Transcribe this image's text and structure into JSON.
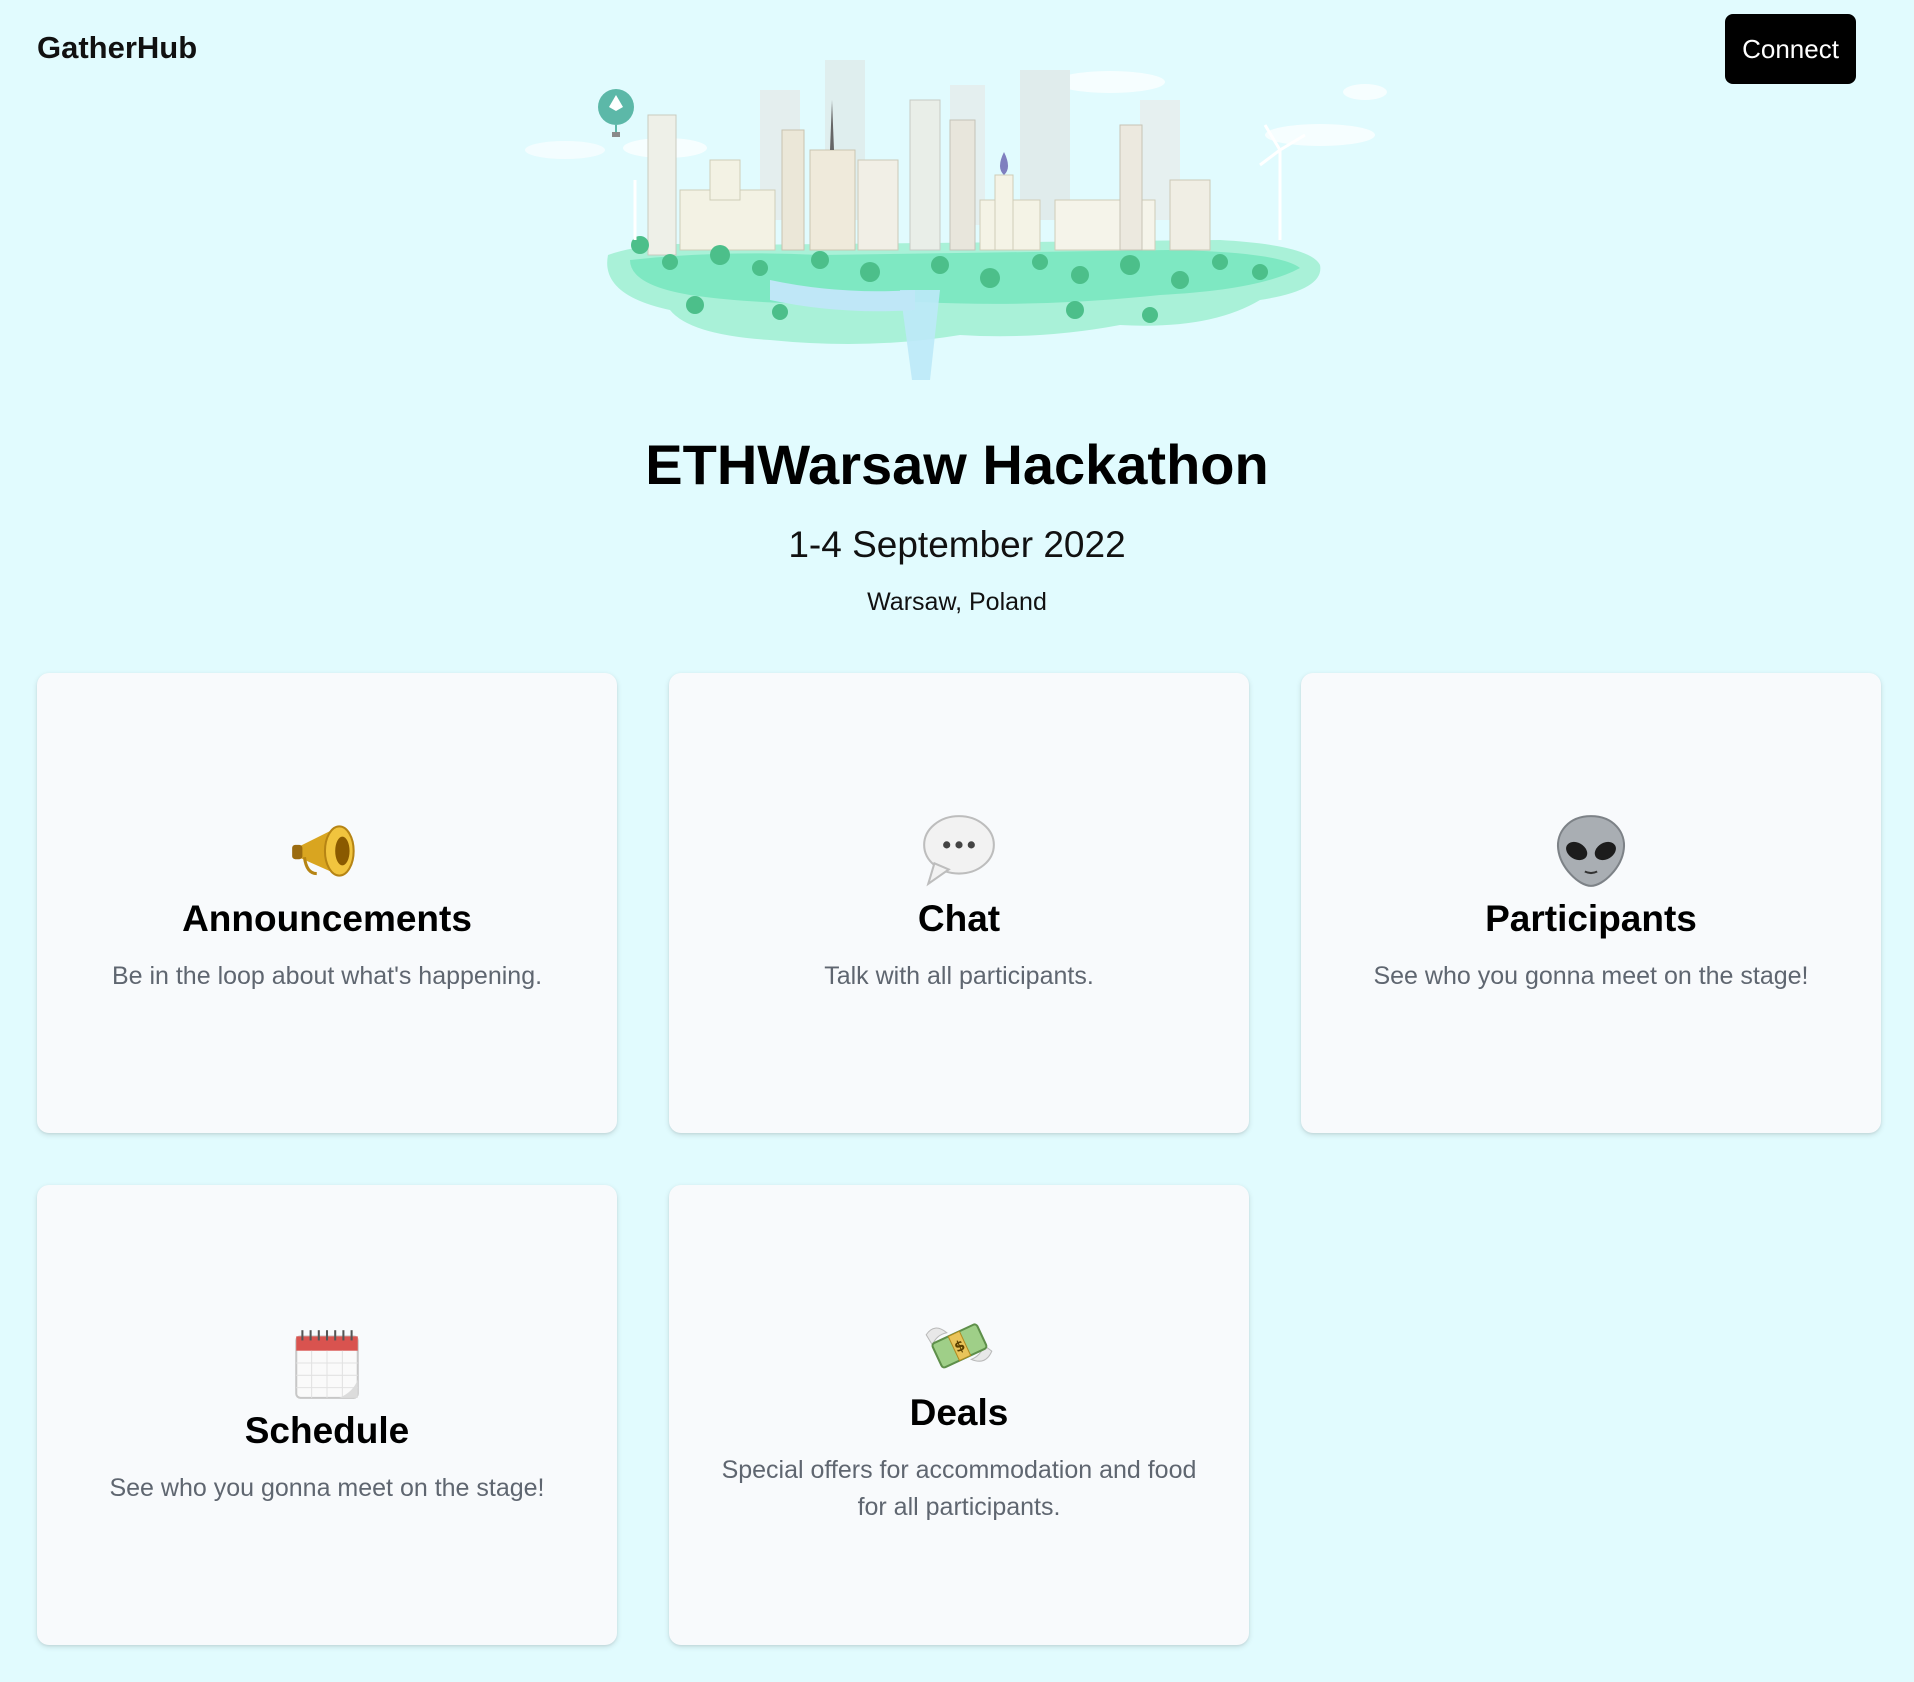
{
  "header": {
    "brand": "GatherHub",
    "connect_label": "Connect"
  },
  "event": {
    "title": "ETHWarsaw Hackathon",
    "dates": "1-4 September 2022",
    "location": "Warsaw, Poland"
  },
  "cards": [
    {
      "title": "Announcements",
      "description": "Be in the loop about what's happening.",
      "icon": "megaphone-icon"
    },
    {
      "title": "Chat",
      "description": "Talk with all participants.",
      "icon": "speech-bubble-icon"
    },
    {
      "title": "Participants",
      "description": "See who you gonna meet on the stage!",
      "icon": "alien-icon"
    },
    {
      "title": "Schedule",
      "description": "See who you gonna meet on the stage!",
      "icon": "calendar-icon"
    },
    {
      "title": "Deals",
      "description": "Special offers for accommodation and food for all participants.",
      "icon": "money-with-wings-icon"
    }
  ],
  "colors": {
    "background": "#e1fbfe",
    "card": "#f8fafc",
    "button": "#000000",
    "accent_green": "#7ee8c2"
  }
}
